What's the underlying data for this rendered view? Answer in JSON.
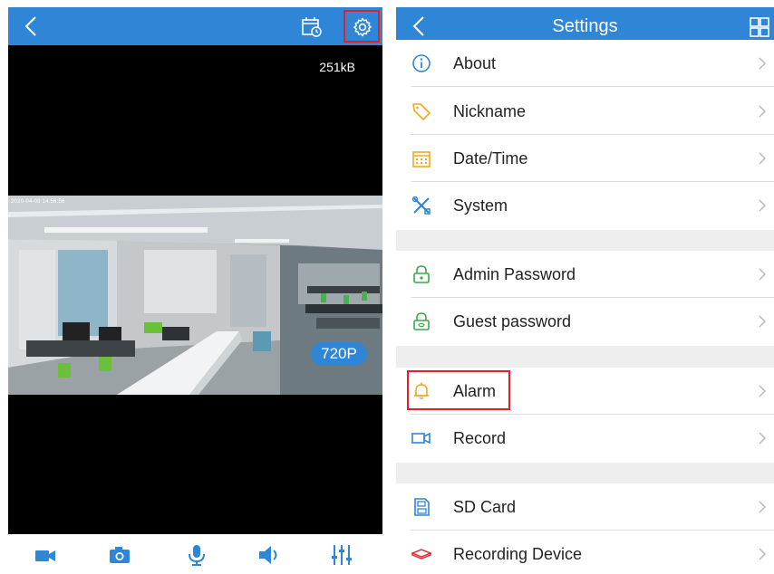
{
  "live_view": {
    "data_rate": "251kB",
    "resolution_badge": "720P",
    "osd_text": "2020-04-08 14:56:56"
  },
  "settings": {
    "title": "Settings",
    "items": [
      {
        "label": "About",
        "icon": "info-icon",
        "color": "#2f86d6"
      },
      {
        "label": "Nickname",
        "icon": "tag-icon",
        "color": "#f5a623"
      },
      {
        "label": "Date/Time",
        "icon": "calendar-icon",
        "color": "#f5a623"
      },
      {
        "label": "System",
        "icon": "tools-icon",
        "color": "#2f86d6"
      },
      {
        "label": "Admin Password",
        "icon": "lock-icon",
        "color": "#3aa94a"
      },
      {
        "label": "Guest password",
        "icon": "lock-icon",
        "color": "#3aa94a"
      },
      {
        "label": "Alarm",
        "icon": "bell-icon",
        "color": "#f5a623"
      },
      {
        "label": "Record",
        "icon": "video-icon",
        "color": "#2f86d6"
      },
      {
        "label": "SD Card",
        "icon": "sd-card-icon",
        "color": "#2f86d6"
      },
      {
        "label": "Recording Device",
        "icon": "nvr-icon",
        "color": "#e0202a"
      }
    ]
  },
  "colors": {
    "accent": "#2f86d6",
    "highlight": "#e0202a"
  }
}
